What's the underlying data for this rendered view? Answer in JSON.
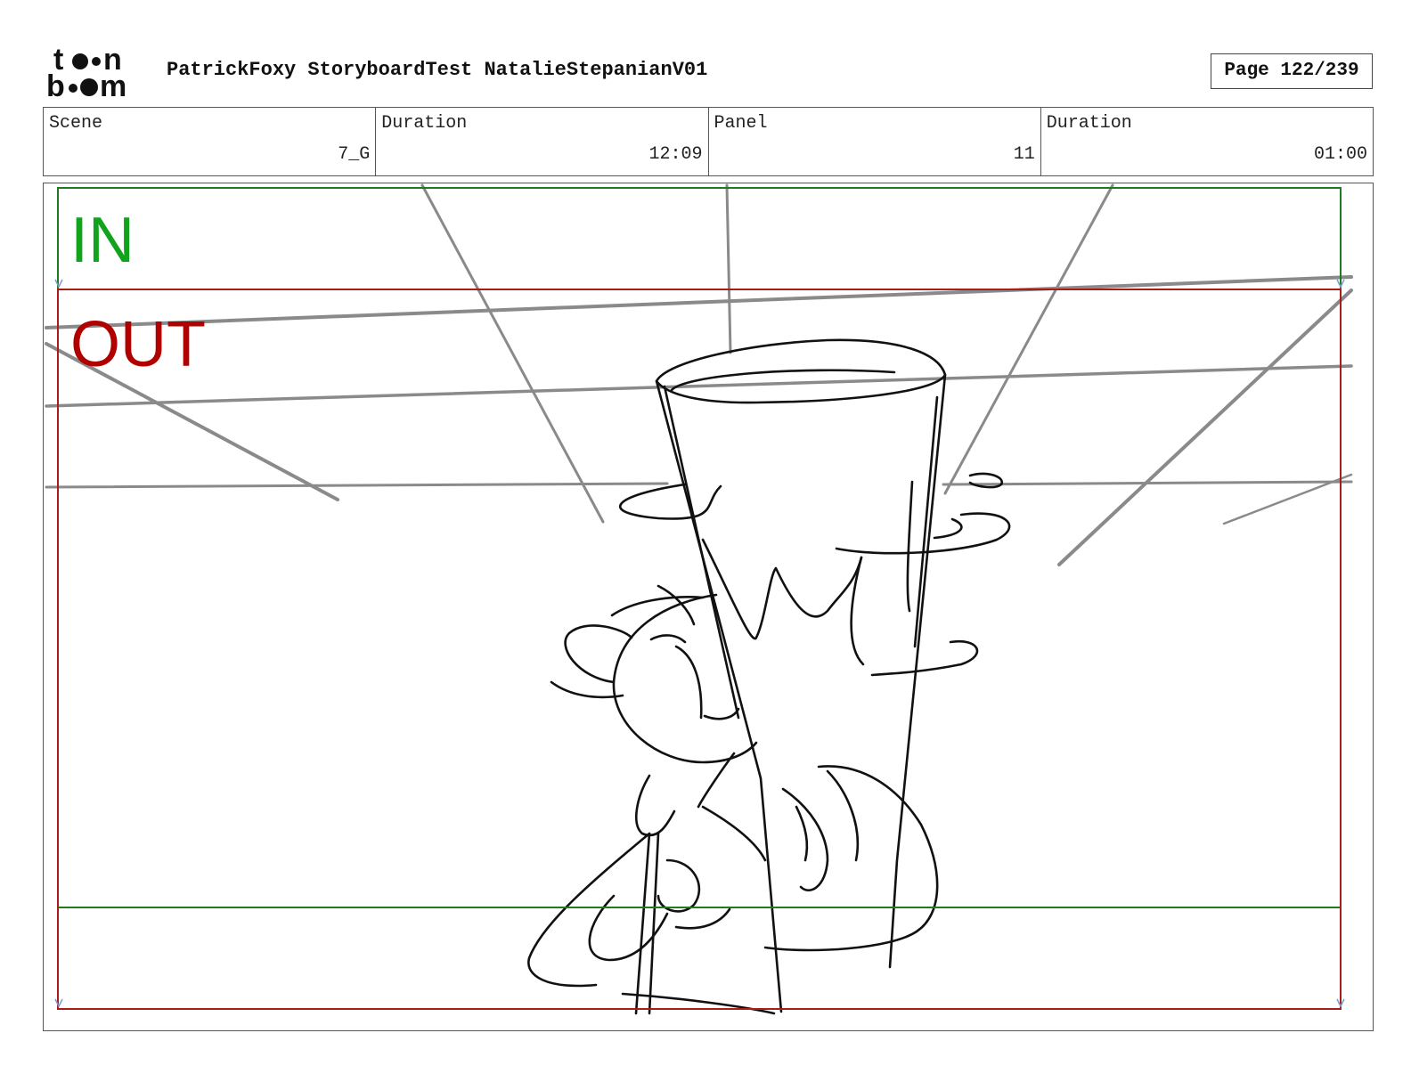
{
  "header": {
    "logo_text": "toon boom",
    "document_title": "PatrickFoxy StoryboardTest NatalieStepanianV01",
    "page_label": "Page 122/239"
  },
  "info": {
    "scene_label": "Scene",
    "scene_value": "7_G",
    "scene_duration_label": "Duration",
    "scene_duration_value": "12:09",
    "panel_label": "Panel",
    "panel_value": "11",
    "panel_duration_label": "Duration",
    "panel_duration_value": "01:00"
  },
  "frame": {
    "in_label": "IN",
    "out_label": "OUT",
    "in_color": "#11a31c",
    "out_color": "#b00000"
  }
}
